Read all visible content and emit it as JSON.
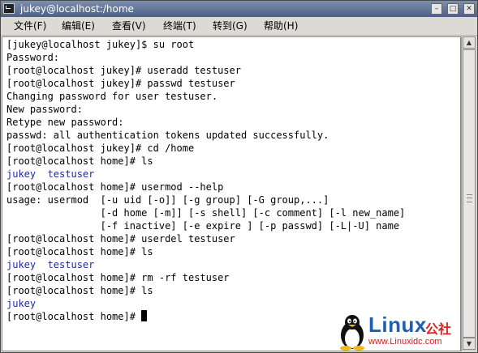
{
  "window": {
    "title": "jukey@localhost:/home",
    "buttons": [
      "–",
      "□",
      "✕"
    ]
  },
  "menu": [
    "文件(F)",
    "编辑(E)",
    "查看(V)",
    "终端(T)",
    "转到(G)",
    "帮助(H)"
  ],
  "terminal": {
    "lines": [
      {
        "text": "[jukey@localhost jukey]$ su root",
        "color": "black"
      },
      {
        "text": "Password:",
        "color": "black"
      },
      {
        "text": "[root@localhost jukey]# useradd testuser",
        "color": "black"
      },
      {
        "text": "[root@localhost jukey]# passwd testuser",
        "color": "black"
      },
      {
        "text": "Changing password for user testuser.",
        "color": "black"
      },
      {
        "text": "New password:",
        "color": "black"
      },
      {
        "text": "Retype new password:",
        "color": "black"
      },
      {
        "text": "passwd: all authentication tokens updated successfully.",
        "color": "black"
      },
      {
        "text": "[root@localhost jukey]# cd /home",
        "color": "black"
      },
      {
        "text": "[root@localhost home]# ls",
        "color": "black"
      },
      {
        "text": "jukey  testuser",
        "color": "blue"
      },
      {
        "text": "[root@localhost home]# usermod --help",
        "color": "black"
      },
      {
        "text": "usage: usermod  [-u uid [-o]] [-g group] [-G group,...]",
        "color": "black"
      },
      {
        "text": "                [-d home [-m]] [-s shell] [-c comment] [-l new_name]",
        "color": "black"
      },
      {
        "text": "                [-f inactive] [-e expire ] [-p passwd] [-L|-U] name",
        "color": "black"
      },
      {
        "text": "[root@localhost home]# userdel testuser",
        "color": "black"
      },
      {
        "text": "[root@localhost home]# ls",
        "color": "black"
      },
      {
        "text": "jukey  testuser",
        "color": "blue"
      },
      {
        "text": "[root@localhost home]# rm -rf testuser",
        "color": "black"
      },
      {
        "text": "[root@localhost home]# ls",
        "color": "black"
      },
      {
        "text": "jukey",
        "color": "blue"
      },
      {
        "text": "[root@localhost home]# ",
        "color": "black",
        "cursor": true
      }
    ],
    "colors": {
      "blue": "#1d2b9c",
      "black": "#000000"
    }
  },
  "watermark": {
    "logo_text": "Linux",
    "logo_cn": "公社",
    "url": "www.Linuxidc.com",
    "icon": "tux-penguin-icon"
  }
}
